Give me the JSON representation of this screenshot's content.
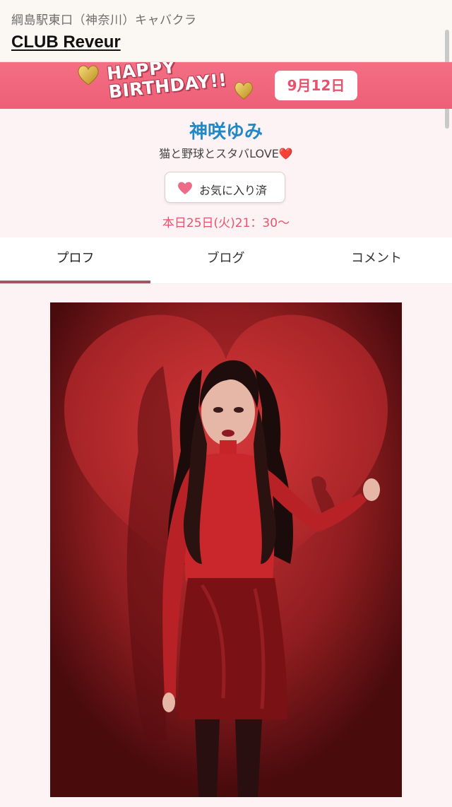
{
  "header": {
    "area_label": "綱島駅東口（神奈川）キャバクラ",
    "club_name": "CLUB Reveur"
  },
  "birthday_banner": {
    "line1": "HAPPY",
    "line2": "BIRTHDAY!!",
    "date": "9月12日",
    "bg_color": "#ef647b"
  },
  "profile": {
    "name": "神咲ゆみ",
    "tagline": "猫と野球とスタバLOVE",
    "tagline_emoji": "❤️",
    "favorite_button_label": "お気に入り済",
    "schedule": "本日25日(火)21：30〜"
  },
  "tabs": [
    {
      "label": "プロフ",
      "active": true
    },
    {
      "label": "ブログ",
      "active": false
    },
    {
      "label": "コメント",
      "active": false
    }
  ],
  "colors": {
    "accent_pink": "#e8546c",
    "name_blue": "#2288c6",
    "tab_indicator": "#a0585e"
  }
}
